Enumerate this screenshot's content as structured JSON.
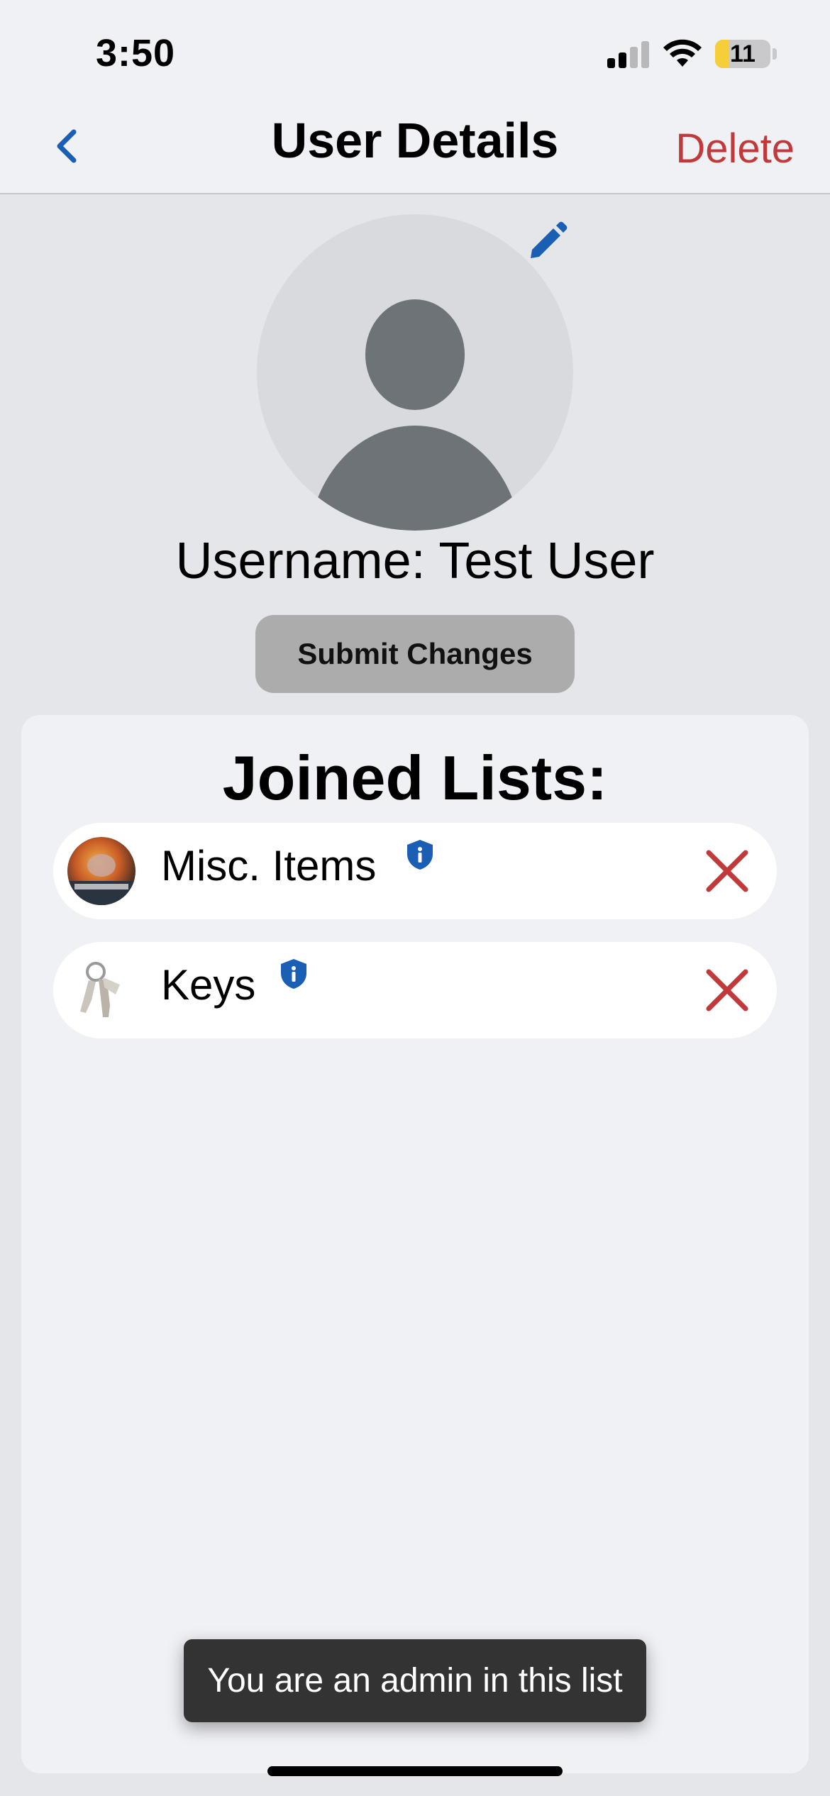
{
  "status_bar": {
    "time": "3:50",
    "battery_level": "11",
    "battery_fraction": 0.26
  },
  "navbar": {
    "title": "User Details",
    "delete_label": "Delete",
    "back_icon": "chevron-left-icon"
  },
  "profile": {
    "edit_icon": "pencil-icon",
    "username_text": "Username: Test User",
    "submit_label": "Submit Changes"
  },
  "joined_lists": {
    "title": "Joined Lists:",
    "items": [
      {
        "name": "Misc. Items",
        "badge_icon": "shield-info-icon",
        "remove_icon": "close-icon"
      },
      {
        "name": "Keys",
        "badge_icon": "shield-info-icon",
        "remove_icon": "close-icon"
      }
    ]
  },
  "toast": {
    "message": "You are an admin in this list"
  },
  "colors": {
    "accent": "#1b5fb4",
    "danger": "#c0393b",
    "toast_bg": "#333333"
  }
}
